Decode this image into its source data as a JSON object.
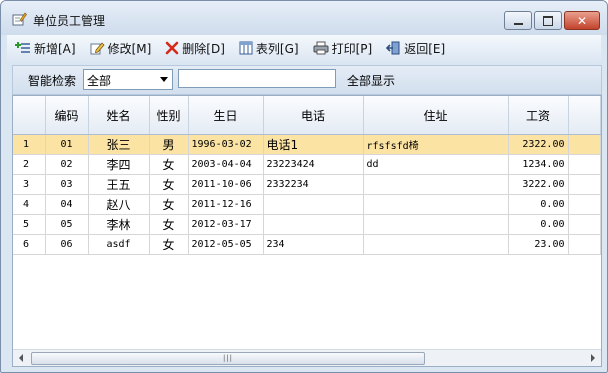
{
  "window": {
    "title": "单位员工管理"
  },
  "toolbar": {
    "add": "新增[A]",
    "edit": "修改[M]",
    "delete": "删除[D]",
    "columns": "表列[G]",
    "print": "打印[P]",
    "back": "返回[E]"
  },
  "search": {
    "label": "智能检索",
    "field_value": "全部",
    "input_value": "",
    "show_all": "全部显示"
  },
  "table": {
    "headers": [
      "",
      "编码",
      "姓名",
      "性别",
      "生日",
      "电话",
      "住址",
      "工资"
    ],
    "rows": [
      [
        "1",
        "01",
        "张三",
        "男",
        "1996-03-02",
        "电话1",
        "rfsfsfd椅",
        "2322.00"
      ],
      [
        "2",
        "02",
        "李四",
        "女",
        "2003-04-04",
        "23223424",
        "dd",
        "1234.00"
      ],
      [
        "3",
        "03",
        "王五",
        "女",
        "2011-10-06",
        "2332234",
        "",
        "3222.00"
      ],
      [
        "4",
        "04",
        "赵八",
        "女",
        "2011-12-16",
        "",
        "",
        "0.00"
      ],
      [
        "5",
        "05",
        "李林",
        "女",
        "2012-03-17",
        "",
        "",
        "0.00"
      ],
      [
        "6",
        "06",
        "asdf",
        "女",
        "2012-05-05",
        "234",
        "",
        "23.00"
      ]
    ],
    "selected_row": 0
  },
  "colors": {
    "selected_row": "#fbe3a3",
    "window_frame": "#dbe6f3",
    "close_button": "#c2432c"
  },
  "icons": {
    "title": "edit-window-icon",
    "add": "add-list-icon",
    "edit": "pencil-icon",
    "delete": "red-x-icon",
    "columns": "columns-icon",
    "print": "printer-icon",
    "back": "exit-door-icon"
  }
}
